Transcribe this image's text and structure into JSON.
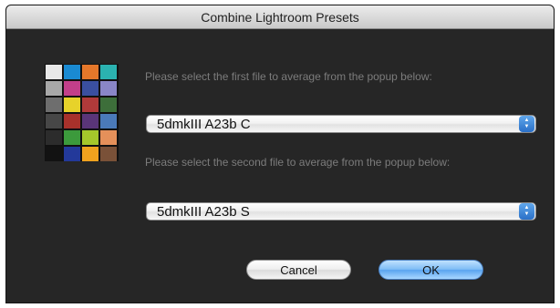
{
  "window": {
    "title": "Combine Lightroom Presets"
  },
  "icon": {
    "name": "color-checker-icon",
    "swatches": [
      "#e8e8e8",
      "#1a8ad2",
      "#e5772a",
      "#2bb2b0",
      "#a8a8a8",
      "#c23f8a",
      "#3a4fa0",
      "#8a86c7",
      "#6e6e6e",
      "#e7d22a",
      "#b03a3a",
      "#3d6e3a",
      "#474747",
      "#a8312b",
      "#5a3579",
      "#4a7ab9",
      "#2c2c2c",
      "#3c9a3c",
      "#a5c72b",
      "#e5905a",
      "#121212",
      "#23399a",
      "#f0a21e",
      "#7a5138"
    ]
  },
  "first": {
    "prompt": "Please select the first file to average from the popup below:",
    "selected": "5dmkIII A23b C"
  },
  "second": {
    "prompt": "Please select the second file to average from the popup below:",
    "selected": "5dmkIII A23b S"
  },
  "buttons": {
    "cancel": "Cancel",
    "ok": "OK"
  },
  "colors": {
    "background": "#262626",
    "accent": "#5aa4ef"
  }
}
